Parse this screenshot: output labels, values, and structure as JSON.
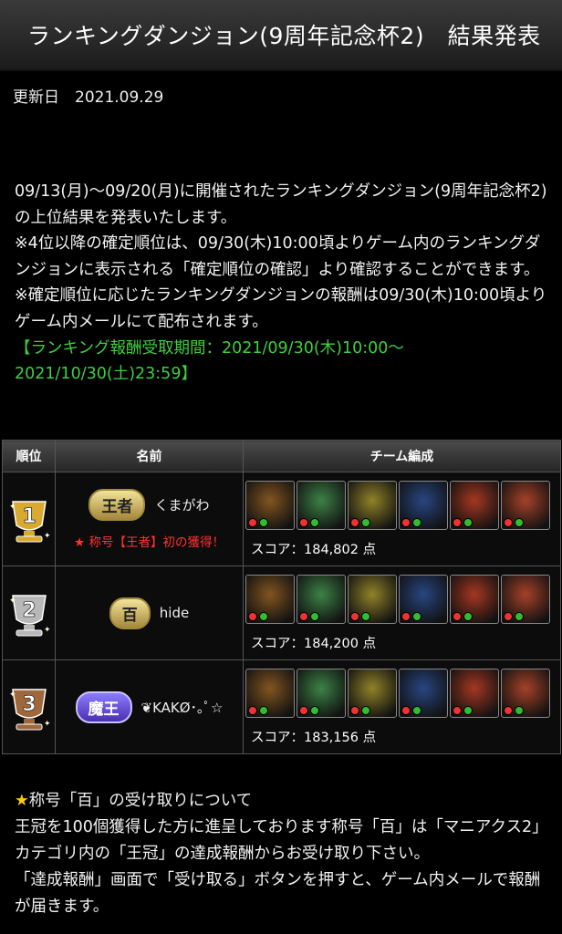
{
  "title": "ランキングダンジョン(9周年記念杯2)　結果発表",
  "updated": "更新日　2021.09.29",
  "intro": {
    "p1": "09/13(月)〜09/20(月)に開催されたランキングダンジョン(9周年記念杯2)の上位結果を発表いたします。",
    "p2": "※4位以降の確定順位は、09/30(木)10:00頃よりゲーム内のランキングダンジョンに表示される「確定順位の確認」より確認することができます。",
    "p3": "※確定順位に応じたランキングダンジョンの報酬は09/30(木)10:00頃よりゲーム内メールにて配布されます。",
    "p4": "【ランキング報酬受取期間：2021/09/30(木)10:00〜2021/10/30(土)23:59】"
  },
  "table": {
    "headers": [
      "順位",
      "名前",
      "チーム編成"
    ],
    "rows": [
      {
        "rank": "1",
        "badge": "王者",
        "name": "くまがわ",
        "note": "★ 称号【王者】初の獲得！",
        "score": "スコア：184,802 点",
        "medal_color": "#d9a930"
      },
      {
        "rank": "2",
        "badge": "百",
        "name": "hide",
        "note": "",
        "score": "スコア：184,200 点",
        "medal_color": "#b8b8b8"
      },
      {
        "rank": "3",
        "badge": "魔王",
        "name": "❦KAKØ･｡ﾟ☆",
        "note": "",
        "score": "スコア：183,156 点",
        "medal_color": "#a0683a"
      }
    ],
    "team_colors": [
      "#8a5a20",
      "#3f8a4a",
      "#9a8a2a",
      "#2a4a8a",
      "#b03a22",
      "#b0452a"
    ]
  },
  "footer": {
    "heading_star": "★",
    "heading": "称号「百」の受け取りについて",
    "p1": "王冠を100個獲得した方に進呈しております称号「百」は「マニアクス2」カテゴリ内の「王冠」の達成報酬からお受け取り下さい。",
    "p2": "「達成報酬」画面で「受け取る」ボタンを押すと、ゲーム内メールで報酬が届きます。"
  }
}
